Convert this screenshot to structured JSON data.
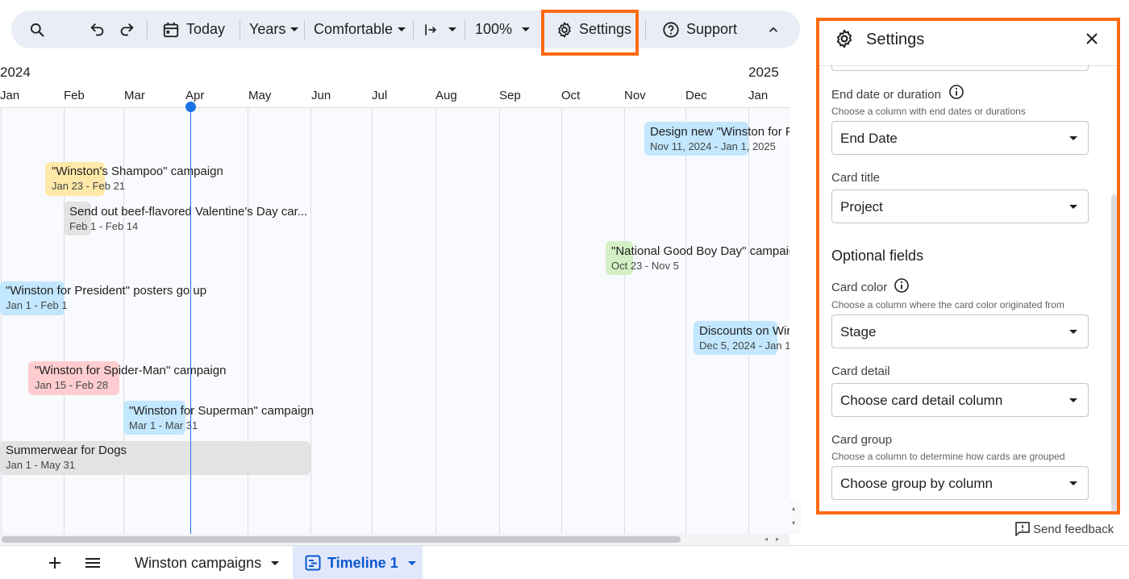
{
  "toolbar": {
    "today_label": "Today",
    "scale_label": "Years",
    "density_label": "Comfortable",
    "zoom_label": "100%",
    "settings_label": "Settings",
    "support_label": "Support"
  },
  "timeline": {
    "year_start": "2024",
    "year_end": "2025",
    "months": [
      "Jan",
      "Feb",
      "Mar",
      "Apr",
      "May",
      "Jun",
      "Jul",
      "Aug",
      "Sep",
      "Oct",
      "Nov",
      "Dec",
      "Jan"
    ],
    "cards": [
      {
        "title": "Design new \"Winston for P",
        "date": "Nov 11, 2024 - Jan 1, 2025",
        "color": "#c2e7ff"
      },
      {
        "title": "\"Winston's Shampoo\" campaign",
        "date": "Jan 23 - Feb 21",
        "color": "#ffe9a8"
      },
      {
        "title": "Send out beef-flavored Valentine's Day car...",
        "date": "Feb 1 - Feb 14",
        "color": "#e3e3e3"
      },
      {
        "title": "\"National Good Boy Day\" campaig",
        "date": "Oct 23 - Nov 5",
        "color": "#d3f0c4"
      },
      {
        "title": "\"Winston for President\" posters go up",
        "date": "Jan 1 - Feb 1",
        "color": "#c2e7ff"
      },
      {
        "title": "Discounts on Wir",
        "date": "Dec 5, 2024 - Jan 1",
        "color": "#c2e7ff"
      },
      {
        "title": "\"Winston for Spider-Man\" campaign",
        "date": "Jan 15 - Feb 28",
        "color": "#ffcdd0"
      },
      {
        "title": "\"Winston for Superman\" campaign",
        "date": "Mar 1 - Mar 31",
        "color": "#c2e7ff"
      },
      {
        "title": "Summerwear for Dogs",
        "date": "Jan 1 - May 31",
        "color": "#e3e3e3"
      }
    ]
  },
  "bottom": {
    "sheet_tab": "Winston campaigns",
    "timeline_tab": "Timeline 1"
  },
  "settings": {
    "title": "Settings",
    "end_date_label": "End date or duration",
    "end_date_help": "Choose a column with end dates or durations",
    "end_date_value": "End Date",
    "card_title_label": "Card title",
    "card_title_value": "Project",
    "optional_heading": "Optional fields",
    "card_color_label": "Card color",
    "card_color_help": "Choose a column where the card color originated from",
    "card_color_value": "Stage",
    "card_detail_label": "Card detail",
    "card_detail_value": "Choose card detail column",
    "card_group_label": "Card group",
    "card_group_help": "Choose a column to determine how cards are grouped",
    "card_group_value": "Choose group by column",
    "feedback_label": "Send feedback"
  },
  "colors": {
    "accent": "#1a73e8",
    "highlight": "#ff6a13",
    "toolbar_bg": "#e9eef6"
  }
}
